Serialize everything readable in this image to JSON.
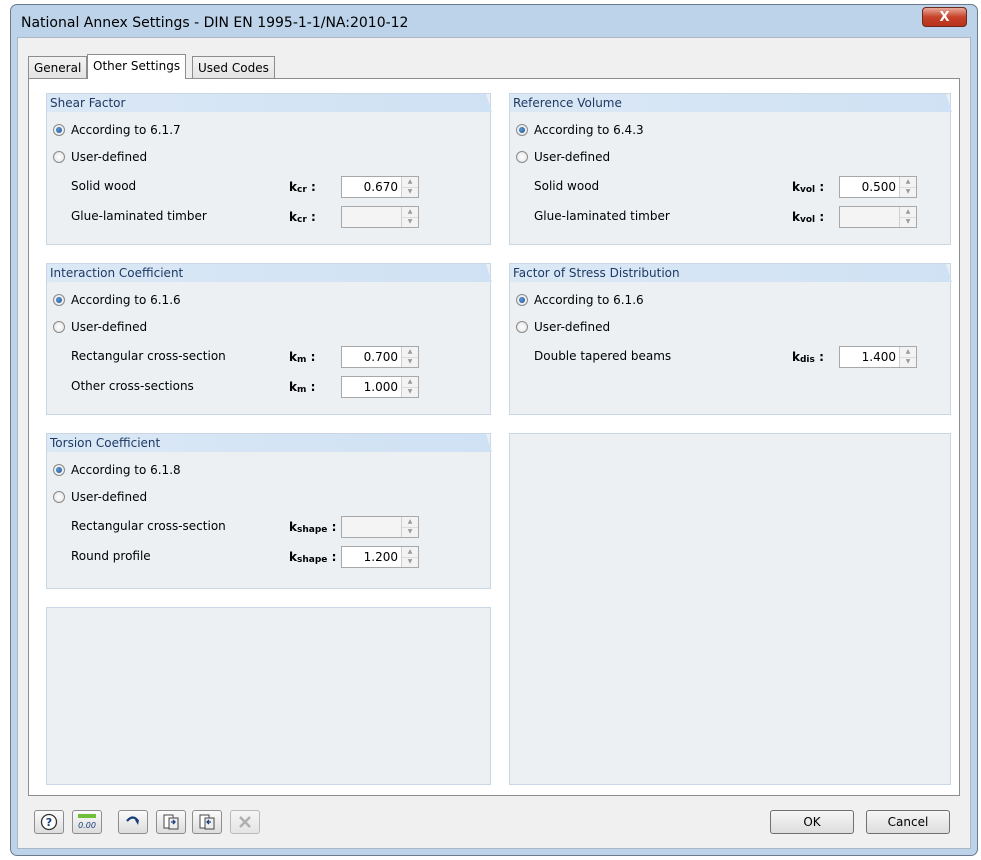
{
  "window": {
    "title": "National Annex Settings - DIN EN 1995-1-1/NA:2010-12",
    "close_label": "X"
  },
  "tabs": [
    {
      "label": "General",
      "active": false
    },
    {
      "label": "Other Settings",
      "active": true
    },
    {
      "label": "Used Codes",
      "active": false
    }
  ],
  "shear_factor": {
    "title": "Shear Factor",
    "option_default": "According to 6.1.7",
    "option_user": "User-defined",
    "selected": "default",
    "params": [
      {
        "label": "Solid wood",
        "symbol": "k",
        "sub": "cr",
        "value": "0.670",
        "enabled": true
      },
      {
        "label": "Glue-laminated timber",
        "symbol": "k",
        "sub": "cr",
        "value": "",
        "enabled": false
      }
    ]
  },
  "reference_volume": {
    "title": "Reference Volume",
    "option_default": "According to 6.4.3",
    "option_user": "User-defined",
    "selected": "default",
    "params": [
      {
        "label": "Solid wood",
        "symbol": "k",
        "sub": "vol",
        "value": "0.500",
        "enabled": true
      },
      {
        "label": "Glue-laminated timber",
        "symbol": "k",
        "sub": "vol",
        "value": "",
        "enabled": false
      }
    ]
  },
  "interaction_coefficient": {
    "title": "Interaction Coefficient",
    "option_default": "According to 6.1.6",
    "option_user": "User-defined",
    "selected": "default",
    "params": [
      {
        "label": "Rectangular cross-section",
        "symbol": "k",
        "sub": "m",
        "value": "0.700",
        "enabled": true
      },
      {
        "label": "Other cross-sections",
        "symbol": "k",
        "sub": "m",
        "value": "1.000",
        "enabled": true
      }
    ]
  },
  "stress_distribution": {
    "title": "Factor of Stress Distribution",
    "option_default": "According to 6.1.6",
    "option_user": "User-defined",
    "selected": "default",
    "params": [
      {
        "label": "Double tapered beams",
        "symbol": "k",
        "sub": "dis",
        "value": "1.400",
        "enabled": true
      }
    ]
  },
  "torsion_coefficient": {
    "title": "Torsion Coefficient",
    "option_default": "According to 6.1.8",
    "option_user": "User-defined",
    "selected": "default",
    "params": [
      {
        "label": "Rectangular cross-section",
        "symbol": "k",
        "sub": "shape",
        "value": "",
        "enabled": false
      },
      {
        "label": "Round profile",
        "symbol": "k",
        "sub": "shape",
        "value": "1.200",
        "enabled": true
      }
    ]
  },
  "symbol_suffix": ":",
  "toolbar": {
    "icons": [
      "help-icon",
      "units-icon",
      "reset-defaults-icon",
      "import-icon",
      "export-icon",
      "delete-icon"
    ],
    "units_icon_text": "0.00"
  },
  "buttons": {
    "ok": "OK",
    "cancel": "Cancel"
  }
}
